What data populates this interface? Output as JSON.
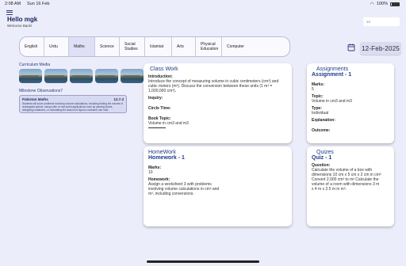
{
  "status_bar": {
    "time": "2:08 AM",
    "date": "Sun 16 Feb",
    "battery": "100%"
  },
  "header": {
    "greeting": "Hello mgk",
    "welcome": "Welcome Back!"
  },
  "search": {
    "value": "10"
  },
  "subjects": [
    "English",
    "Urdu",
    "Maths",
    "Science",
    "Social Studies",
    "Islamiat",
    "Arts",
    "Physical Education",
    "Computer"
  ],
  "active_subject": "Maths",
  "date_selector": {
    "value": "12-Feb-2025"
  },
  "curriculum_media": {
    "label": "Curriculum Media"
  },
  "milestone": {
    "label": "Milestone Observations7",
    "title": "Pakistan Maths",
    "code": "12.7.3",
    "text": "Students will solve problems involving volume calculations, including finding the volume of rectangular prisms, using cubic or real-world applications such as packing boxes, designing containers, or calculating the amount of liquid a container can hold."
  },
  "classwork": {
    "title": "Class Work",
    "fields": [
      {
        "label": "Introduction:",
        "value": "Introduce the concept of measuring volume in cubic centimeters (cm³) and cubic meters (m³). Discuss the conversion between these units (1 m³ = 1,000,000 cm³)."
      },
      {
        "label": "Inquiry:",
        "value": ""
      },
      {
        "label": "Circle Time:",
        "value": ""
      },
      {
        "label": "Book Topic:",
        "value": "Volume in cm3 and m3"
      }
    ]
  },
  "assignments": {
    "title": "Assignments",
    "subtitle": "Assignment - 1",
    "fields": [
      {
        "label": "Marks:",
        "value": "5"
      },
      {
        "label": "Topic:",
        "value": "Volume in cm3 and m3"
      },
      {
        "label": "Type:",
        "value": "Individual"
      },
      {
        "label": "Explanation:",
        "value": ""
      },
      {
        "label": "Outcome:",
        "value": ""
      }
    ]
  },
  "homework": {
    "title": "HomeWork",
    "subtitle": "Homework - 1",
    "fields": [
      {
        "label": "Marks:",
        "value": "10"
      },
      {
        "label": "Homework:",
        "value": "Assign a worksheet 3 with problems involving volume calculations in cm³ and m³, including conversions."
      }
    ]
  },
  "quizes": {
    "title": "Quizes",
    "subtitle": "Quiz - 1",
    "fields": [
      {
        "label": "Question:",
        "value": "Calculate the volume of a box with dimensions 10 cm x 5 cm x 2 cm in cm³ Convert 2,000 cm³ to m³ Calculate the volume of a room with dimensions 3 m x 4 m x 2.5 m in m³."
      }
    ]
  }
}
